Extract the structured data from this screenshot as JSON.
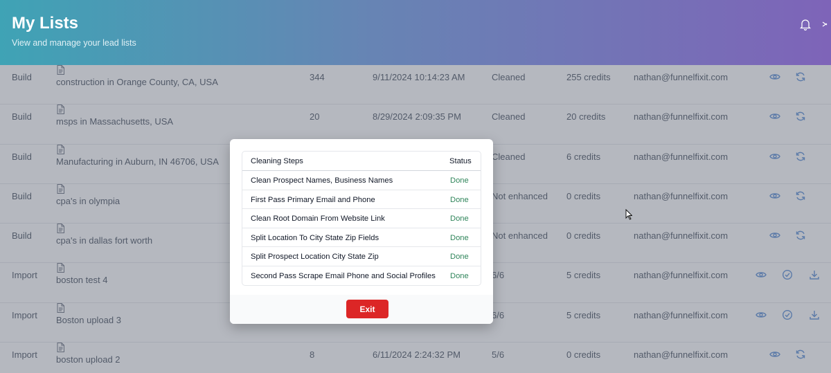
{
  "header": {
    "title": "My Lists",
    "subtitle": "View and manage your lead lists"
  },
  "rows": [
    {
      "type": "Build",
      "name": "construction in Orange County, CA, USA",
      "count": "344",
      "date": "9/11/2024 10:14:23 AM",
      "status": "Cleaned",
      "credits": "255 credits",
      "email": "nathan@funnelfixit.com",
      "actions": [
        "view",
        "refresh"
      ]
    },
    {
      "type": "Build",
      "name": "msps in Massachusetts, USA",
      "count": "20",
      "date": "8/29/2024 2:09:35 PM",
      "status": "Cleaned",
      "credits": "20 credits",
      "email": "nathan@funnelfixit.com",
      "actions": [
        "view",
        "refresh"
      ]
    },
    {
      "type": "Build",
      "name": "Manufacturing in Auburn, IN 46706, USA",
      "count": "",
      "date": "",
      "status": "Cleaned",
      "credits": "6 credits",
      "email": "nathan@funnelfixit.com",
      "actions": [
        "view",
        "refresh"
      ]
    },
    {
      "type": "Build",
      "name": "cpa's in olympia",
      "count": "",
      "date": "",
      "status": "Not enhanced",
      "credits": "0 credits",
      "email": "nathan@funnelfixit.com",
      "actions": [
        "view",
        "refresh"
      ]
    },
    {
      "type": "Build",
      "name": "cpa's in dallas fort worth",
      "count": "",
      "date": "",
      "status": "Not enhanced",
      "credits": "0 credits",
      "email": "nathan@funnelfixit.com",
      "actions": [
        "view",
        "refresh"
      ]
    },
    {
      "type": "Import",
      "name": "boston test 4",
      "count": "",
      "date": "",
      "status": "6/6",
      "credits": "5 credits",
      "email": "nathan@funnelfixit.com",
      "actions": [
        "view",
        "check",
        "download"
      ]
    },
    {
      "type": "Import",
      "name": "Boston upload 3",
      "count": "",
      "date": "",
      "status": "6/6",
      "credits": "5 credits",
      "email": "nathan@funnelfixit.com",
      "actions": [
        "view",
        "check",
        "download"
      ]
    },
    {
      "type": "Import",
      "name": "boston upload 2",
      "count": "8",
      "date": "6/11/2024 2:24:32 PM",
      "status": "5/6",
      "credits": "0 credits",
      "email": "nathan@funnelfixit.com",
      "actions": [
        "view",
        "refresh"
      ]
    }
  ],
  "modal": {
    "col_steps": "Cleaning Steps",
    "col_status": "Status",
    "steps": [
      {
        "label": "Clean Prospect Names, Business Names",
        "status": "Done"
      },
      {
        "label": "First Pass Primary Email and Phone",
        "status": "Done"
      },
      {
        "label": "Clean Root Domain From Website Link",
        "status": "Done"
      },
      {
        "label": "Split Location To City State Zip Fields",
        "status": "Done"
      },
      {
        "label": "Split Prospect Location City State Zip",
        "status": "Done"
      },
      {
        "label": "Second Pass Scrape Email Phone and Social Profiles",
        "status": "Done"
      }
    ],
    "exit_label": "Exit"
  },
  "colors": {
    "accent_blue": "#5b8fd6",
    "done_green": "#2f855a",
    "exit_red": "#dc2626"
  }
}
